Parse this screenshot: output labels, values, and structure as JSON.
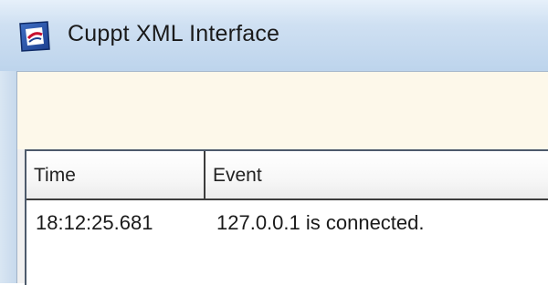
{
  "window": {
    "title": "Cuppt XML Interface",
    "app_icon": "app-icon"
  },
  "log_table": {
    "columns": [
      "Time",
      "Event"
    ],
    "rows": [
      {
        "time": "18:12:25.681",
        "event": "127.0.0.1 is connected."
      }
    ]
  },
  "colors": {
    "titlebar": "#c3d8ee",
    "panel_background": "#fdf8ea",
    "list_background": "#ffffff"
  }
}
